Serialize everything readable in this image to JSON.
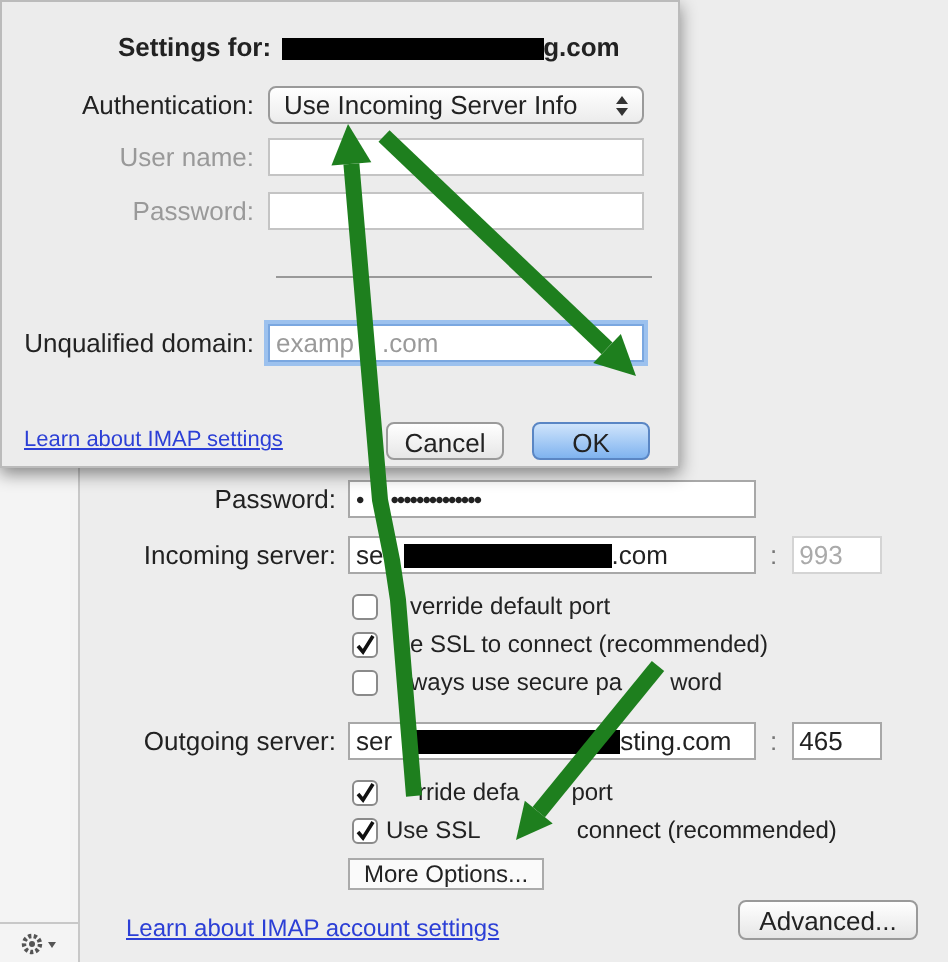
{
  "dialog": {
    "title_label": "Settings for:",
    "title_visible_end": "g.com",
    "rows": [
      {
        "kind": "popup",
        "label": "Authentication:",
        "value": "Use Incoming Server Info",
        "disabled": false,
        "focused": false
      },
      {
        "kind": "text",
        "label": "User name:",
        "disabled": true,
        "focused": false
      },
      {
        "kind": "text",
        "label": "Password:",
        "disabled": true,
        "focused": false
      },
      {
        "kind": "separator"
      },
      {
        "kind": "text",
        "label": "Unqualified domain:",
        "placeholder_parts": [
          "examp",
          ".com"
        ],
        "disabled": false,
        "focused": true
      }
    ],
    "link": "Learn about IMAP settings",
    "buttons": [
      {
        "label": "Cancel",
        "default": false
      },
      {
        "label": "OK",
        "default": true
      }
    ]
  },
  "account": {
    "rows": [
      {
        "kind": "field",
        "label": "Password:",
        "value_parts": [
          "•",
          "••••••••••••••"
        ]
      },
      {
        "kind": "server",
        "label": "Incoming server:",
        "value_start": "se",
        "value_end": ".com",
        "port_separator": ":",
        "port": "993",
        "port_disabled": true
      },
      {
        "kind": "checkbox",
        "parts": [
          "verride default port"
        ],
        "lead_covered": true,
        "checked": false
      },
      {
        "kind": "checkbox",
        "parts": [
          "e SSL to connect (recommended)"
        ],
        "lead_covered": true,
        "checked": true
      },
      {
        "kind": "checkbox",
        "parts": [
          "ways use secure pa",
          "word"
        ],
        "lead_covered": true,
        "checked": false
      },
      {
        "kind": "server",
        "label": "Outgoing server:",
        "value_start": "ser",
        "value_end": "sting.com",
        "port_separator": ":",
        "port": "465",
        "port_disabled": false
      },
      {
        "kind": "checkbox",
        "parts": [
          "rride defa",
          "port"
        ],
        "lead_covered": true,
        "checked": true
      },
      {
        "kind": "checkbox",
        "parts": [
          "Use SSL",
          "connect (recommended)"
        ],
        "lead_covered": false,
        "checked": true
      },
      {
        "kind": "button",
        "label": "More Options..."
      }
    ],
    "link": "Learn about IMAP account settings",
    "advanced_button": "Advanced..."
  }
}
